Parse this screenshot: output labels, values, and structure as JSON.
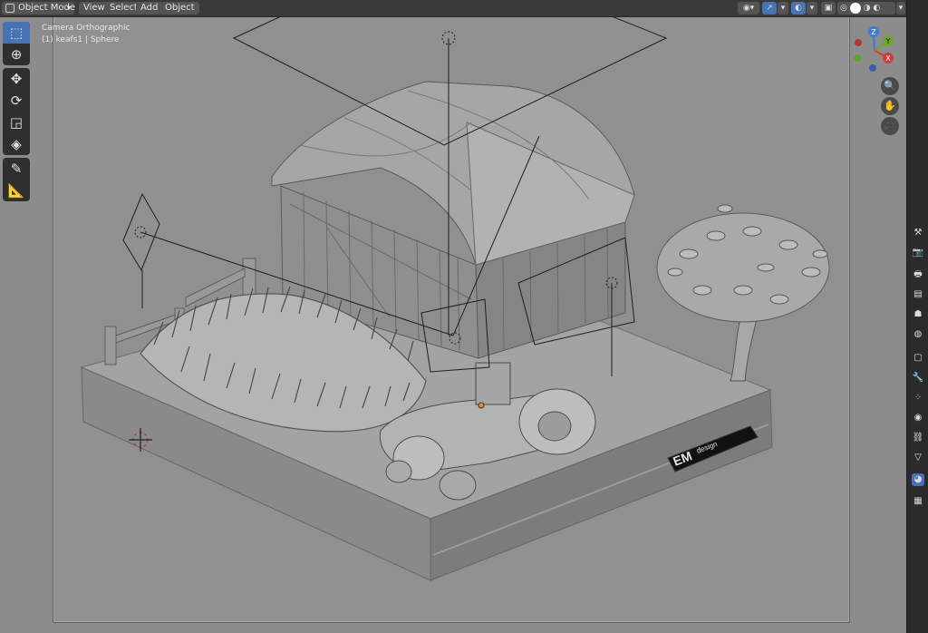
{
  "header": {
    "mode_label": "Object Mode",
    "menu": {
      "view": "View",
      "select": "Select",
      "add": "Add",
      "object": "Object"
    }
  },
  "viewport": {
    "camera_label": "Camera Orthographic",
    "object_label": "(1) keafs1 | Sphere"
  },
  "gizmo": {
    "z": "Z",
    "y": "Y",
    "x": "X"
  },
  "logo": {
    "mark": "EM",
    "text": "design"
  },
  "colors": {
    "accent": "#4772b3",
    "axis_x": "#d33b3b",
    "axis_y": "#6aa82a",
    "axis_z": "#3d79d6",
    "viewport_bg": "#8c8c8c"
  },
  "icons": {
    "select_box": "select-box-icon",
    "cursor": "cursor-icon",
    "move": "move-icon",
    "rotate": "rotate-icon",
    "scale": "scale-icon",
    "transform": "transform-icon",
    "annotate": "annotate-icon",
    "measure": "measure-icon",
    "zoom": "zoom-icon",
    "pan": "hand-icon",
    "camera": "camera-icon"
  }
}
